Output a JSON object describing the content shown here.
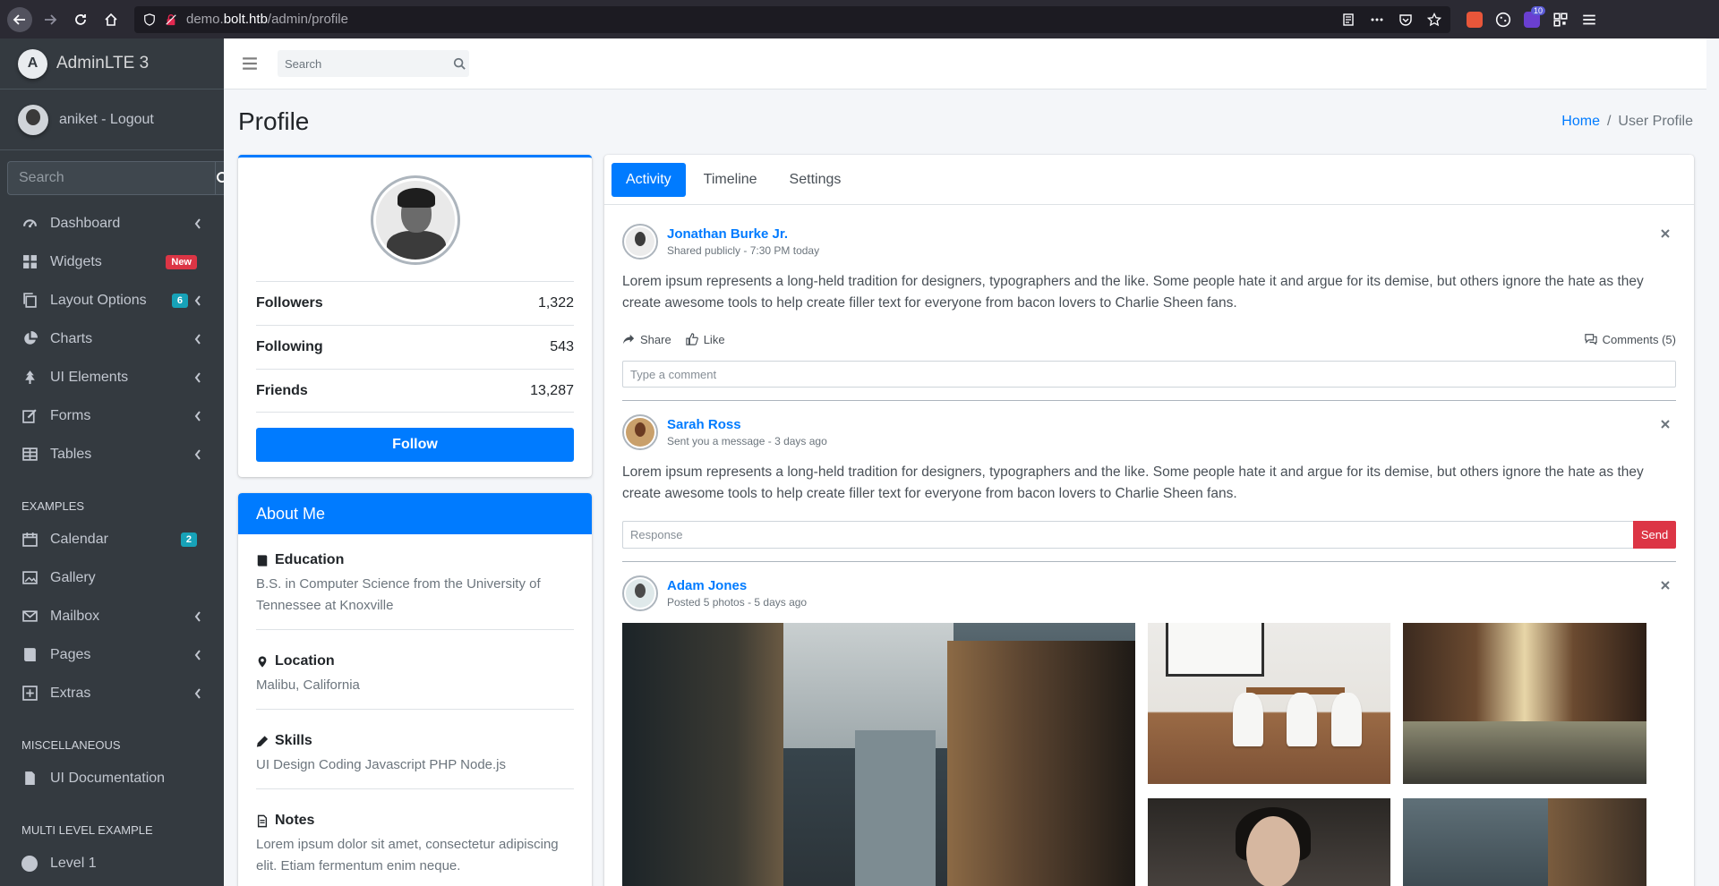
{
  "browser": {
    "url_prefix": "demo.",
    "url_domain": "bolt.htb",
    "url_path": "/admin/profile",
    "extension_badge": "10"
  },
  "sidebar": {
    "brand": "AdminLTE 3",
    "brand_logo": "A",
    "user": "aniket - Logout",
    "search_placeholder": "Search",
    "items": [
      {
        "label": "Dashboard",
        "icon": "dashboard-icon",
        "chevron": true
      },
      {
        "label": "Widgets",
        "icon": "widgets-icon",
        "badge": "New",
        "badge_color": "#dc3545"
      },
      {
        "label": "Layout Options",
        "icon": "copy-icon",
        "badge": "6",
        "badge_color": "#17a2b8",
        "chevron": true
      },
      {
        "label": "Charts",
        "icon": "pie-chart-icon",
        "chevron": true
      },
      {
        "label": "UI Elements",
        "icon": "tree-icon",
        "chevron": true
      },
      {
        "label": "Forms",
        "icon": "edit-icon",
        "chevron": true
      },
      {
        "label": "Tables",
        "icon": "table-icon",
        "chevron": true
      }
    ],
    "examples_header": "EXAMPLES",
    "examples": [
      {
        "label": "Calendar",
        "icon": "calendar-icon",
        "badge": "2",
        "badge_color": "#17a2b8"
      },
      {
        "label": "Gallery",
        "icon": "image-icon"
      },
      {
        "label": "Mailbox",
        "icon": "envelope-icon",
        "chevron": true
      },
      {
        "label": "Pages",
        "icon": "book-icon",
        "chevron": true
      },
      {
        "label": "Extras",
        "icon": "plus-square-icon",
        "chevron": true
      }
    ],
    "misc_header": "MISCELLANEOUS",
    "misc": [
      {
        "label": "UI Documentation",
        "icon": "file-icon"
      }
    ],
    "multi_header": "MULTI LEVEL EXAMPLE",
    "multi": [
      {
        "label": "Level 1",
        "icon": "circle-icon"
      }
    ]
  },
  "topnav": {
    "search_placeholder": "Search"
  },
  "header": {
    "title": "Profile",
    "breadcrumb_home": "Home",
    "breadcrumb_sep": "/",
    "breadcrumb_current": "User Profile"
  },
  "profile": {
    "stats": [
      {
        "label": "Followers",
        "value": "1,322"
      },
      {
        "label": "Following",
        "value": "543"
      },
      {
        "label": "Friends",
        "value": "13,287"
      }
    ],
    "follow_label": "Follow"
  },
  "about": {
    "title": "About Me",
    "sections": [
      {
        "title": "Education",
        "icon": "book-icon",
        "text": "B.S. in Computer Science from the University of Tennessee at Knoxville"
      },
      {
        "title": "Location",
        "icon": "map-marker-icon",
        "text": "Malibu, California"
      },
      {
        "title": "Skills",
        "icon": "pencil-icon",
        "text": "UI Design Coding Javascript PHP Node.js"
      },
      {
        "title": "Notes",
        "icon": "file-text-icon",
        "text": "Lorem ipsum dolor sit amet, consectetur adipiscing elit. Etiam fermentum enim neque."
      }
    ]
  },
  "tabs": [
    "Activity",
    "Timeline",
    "Settings"
  ],
  "posts": [
    {
      "user": "Jonathan Burke Jr.",
      "meta": "Shared publicly - 7:30 PM today",
      "text": "Lorem ipsum represents a long-held tradition for designers, typographers and the like. Some people hate it and argue for its demise, but others ignore the hate as they create awesome tools to help create filler text for everyone from bacon lovers to Charlie Sheen fans.",
      "share": "Share",
      "like": "Like",
      "comments": "Comments (5)",
      "comment_placeholder": "Type a comment"
    },
    {
      "user": "Sarah Ross",
      "meta": "Sent you a message - 3 days ago",
      "text": "Lorem ipsum represents a long-held tradition for designers, typographers and the like. Some people hate it and argue for its demise, but others ignore the hate as they create awesome tools to help create filler text for everyone from bacon lovers to Charlie Sheen fans.",
      "response_placeholder": "Response",
      "send": "Send"
    },
    {
      "user": "Adam Jones",
      "meta": "Posted 5 photos - 5 days ago"
    }
  ]
}
